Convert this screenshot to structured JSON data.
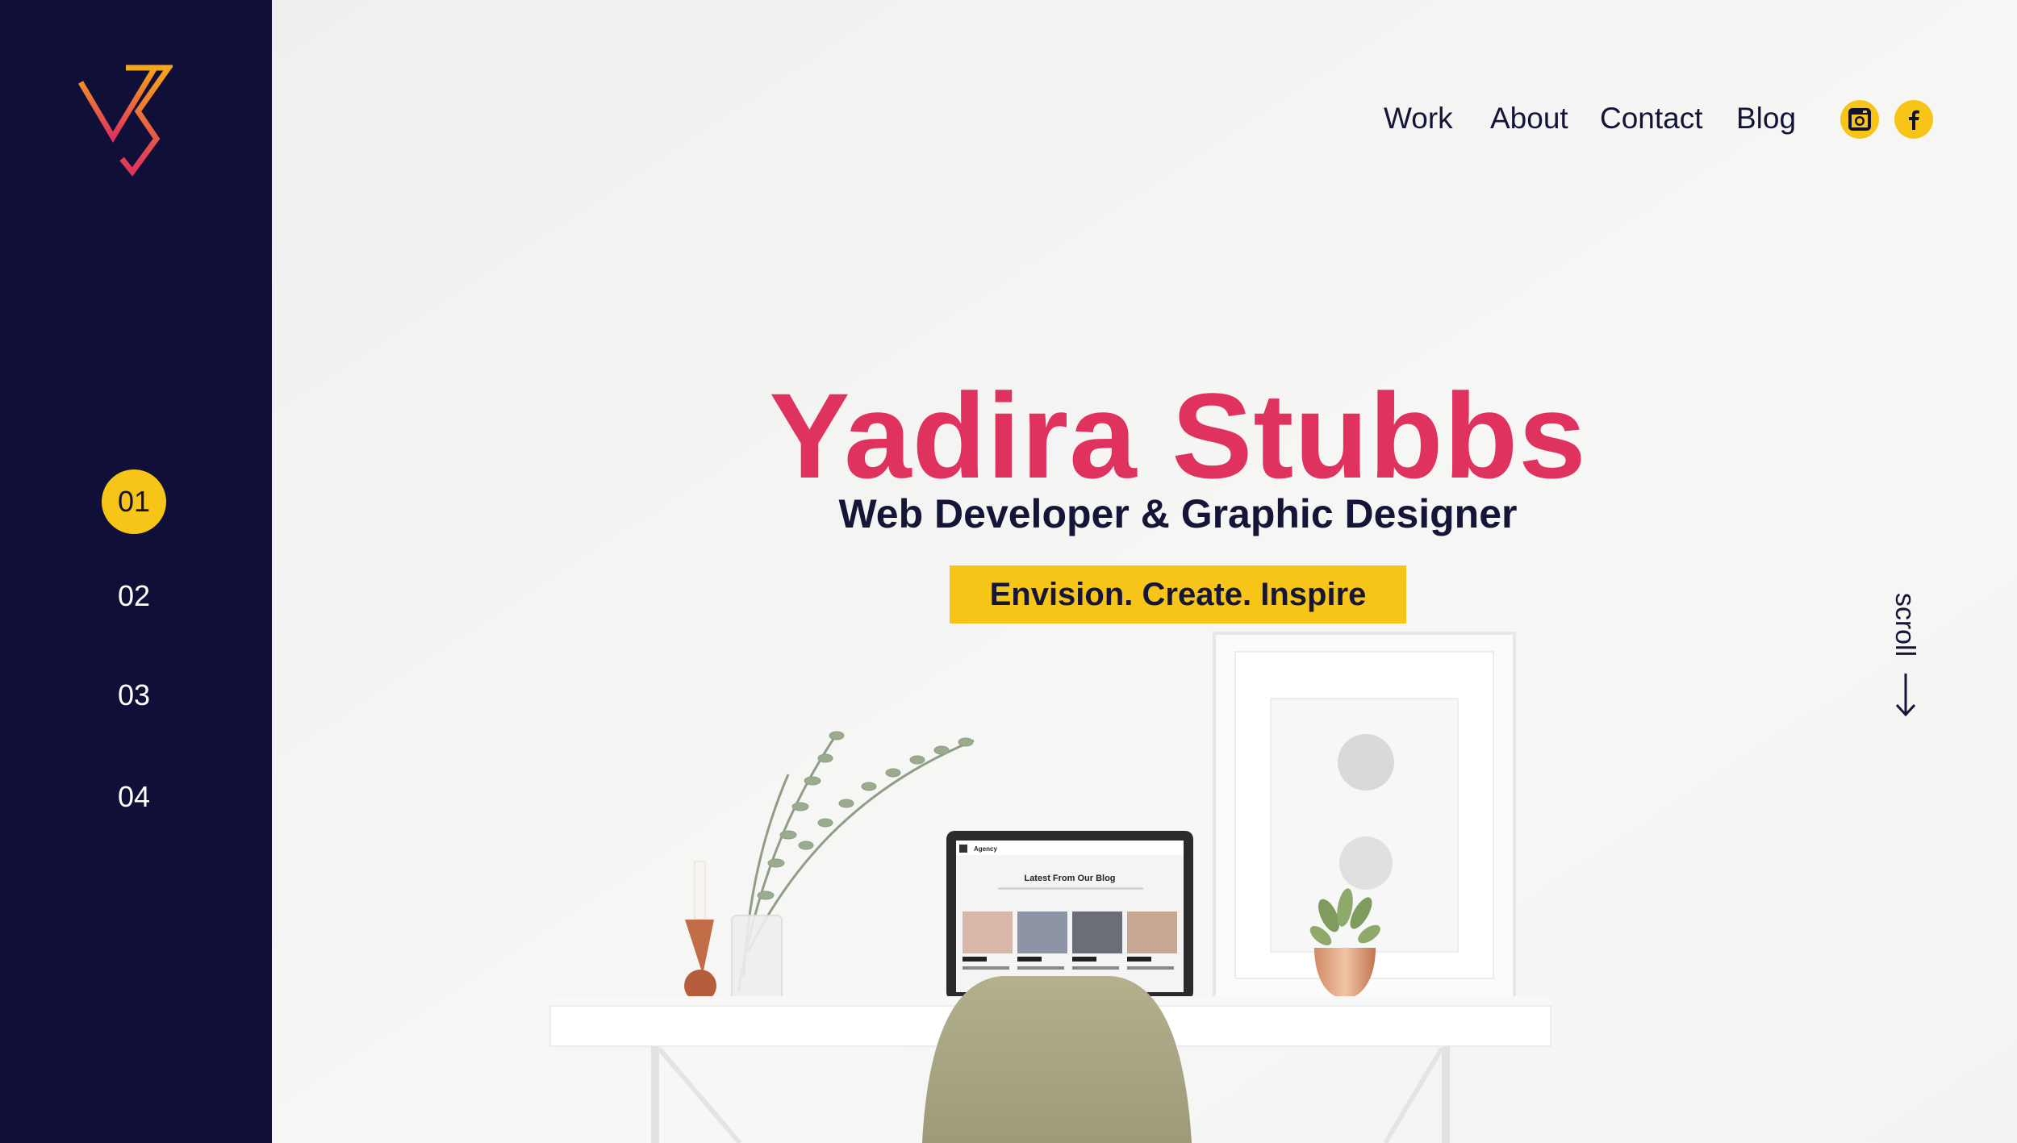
{
  "sidebar": {
    "logo_name": "vs-monogram-logo",
    "pages": [
      "01",
      "02",
      "03",
      "04"
    ],
    "active_page": "01"
  },
  "nav": {
    "links": [
      "Work",
      "About",
      "Contact",
      "Blog"
    ],
    "social": [
      "instagram-icon",
      "facebook-icon"
    ]
  },
  "hero": {
    "name": "Yadira Stubbs",
    "role": "Web Developer & Graphic Designer",
    "tagline": "Envision. Create. Inspire"
  },
  "scroll": {
    "label": "scroll"
  },
  "laptop_screen": {
    "brand": "Agency",
    "heading": "Latest From Our Blog"
  },
  "colors": {
    "sidebar": "#0f0f38",
    "accent_yellow": "#f6c517",
    "accent_pink": "#e0325e",
    "text_dark": "#151538"
  }
}
